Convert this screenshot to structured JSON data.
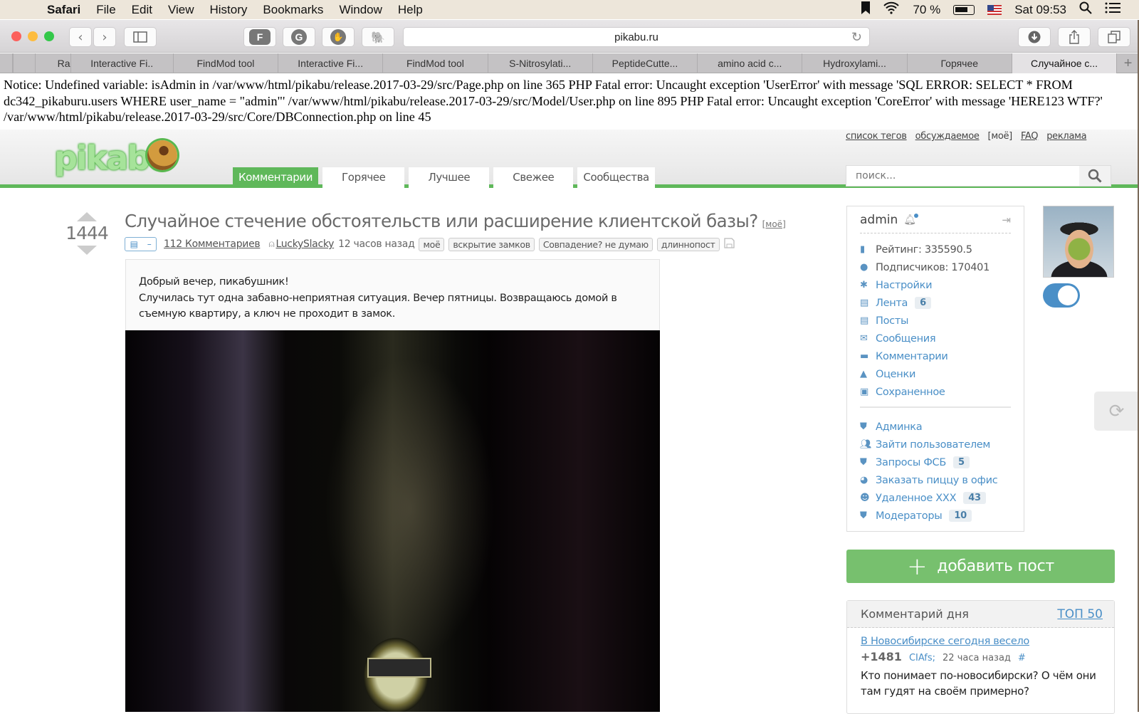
{
  "menubar": {
    "app": "Safari",
    "items": [
      "File",
      "Edit",
      "View",
      "History",
      "Bookmarks",
      "Window",
      "Help"
    ],
    "battery": "70 %",
    "clock": "Sat 09:53"
  },
  "toolbar": {
    "extensions": [
      "F",
      "G",
      "✋",
      "🐘"
    ],
    "url": "pikabu.ru"
  },
  "tabs": [
    {
      "label": ""
    },
    {
      "label": "Ra"
    },
    {
      "label": "Interactive Fi.."
    },
    {
      "label": "FindMod tool"
    },
    {
      "label": "Interactive Fi..."
    },
    {
      "label": "FindMod tool"
    },
    {
      "label": "S-Nitrosylati..."
    },
    {
      "label": "PeptideCutte..."
    },
    {
      "label": "amino acid c..."
    },
    {
      "label": "Hydroxylami..."
    },
    {
      "label": "Горячее"
    },
    {
      "label": "Случайное с..."
    }
  ],
  "error_text": "Notice: Undefined variable: isAdmin in /var/www/html/pikabu/release.2017-03-29/src/Page.php on line 365 PHP Fatal error: Uncaught exception 'UserError' with message 'SQL ERROR: SELECT * FROM dc342_pikaburu.users WHERE user_name = \"admin\"' /var/www/html/pikabu/release.2017-03-29/src/Model/User.php on line 895 PHP Fatal error: Uncaught exception 'CoreError' with message 'HERE123 WTF?' /var/www/html/pikabu/release.2017-03-29/src/Core/DBConnection.php on line 45",
  "header": {
    "logo": "pikabu",
    "nav": [
      "Комментарии",
      "Горячее",
      "Лучшее",
      "Свежее",
      "Сообщества"
    ],
    "top_links": [
      "список тегов",
      "обсуждаемое",
      "[моё]",
      "FAQ",
      "реклама"
    ],
    "search_placeholder": "поиск..."
  },
  "post": {
    "rating": "1444",
    "title": "Случайное стечение обстоятельств или расширение клиентской базы?",
    "title_tag": "[моё]",
    "comments": "112 Комментариев",
    "author": "LuckySlacky",
    "time": "12 часов назад",
    "tags": [
      "моё",
      "вскрытие замков",
      "Совпадение? не думаю",
      "длиннопост"
    ],
    "body_line1": "Добрый вечер, пикабушник!",
    "body_line2": "Случилась тут одна забавно-неприятная ситуация. Вечер пятницы. Возвращаюсь домой в съемную квартиру, а ключ не проходит в замок."
  },
  "user": {
    "name": "admin",
    "rating": "Рейтинг: 335590.5",
    "subscribers": "Подписчиков: 170401",
    "menu": [
      {
        "label": "Настройки",
        "icon": "gear-icon",
        "badge": null
      },
      {
        "label": "Лента",
        "icon": "feed-icon",
        "badge": "6"
      },
      {
        "label": "Посты",
        "icon": "posts-icon",
        "badge": null
      },
      {
        "label": "Сообщения",
        "icon": "mail-icon",
        "badge": null
      },
      {
        "label": "Комментарии",
        "icon": "comment-icon",
        "badge": null
      },
      {
        "label": "Оценки",
        "icon": "triangle-up-icon",
        "badge": null
      },
      {
        "label": "Сохраненное",
        "icon": "save-icon",
        "badge": null
      }
    ],
    "admin_menu": [
      {
        "label": "Админка",
        "icon": "shield-icon",
        "badge": null
      },
      {
        "label": "Зайти пользователем",
        "icon": "users-icon",
        "badge": null
      },
      {
        "label": "Запросы ФСБ",
        "icon": "shield-question-icon",
        "badge": "5"
      },
      {
        "label": "Заказать пиццу в офис",
        "icon": "pie-icon",
        "badge": null
      },
      {
        "label": "Удаленное XXX",
        "icon": "smile-icon",
        "badge": "43"
      },
      {
        "label": "Модераторы",
        "icon": "shield-icon",
        "badge": "10"
      }
    ],
    "toggle_on": true
  },
  "add_post": "добавить пост",
  "comment_of_day": {
    "title": "Комментарий дня",
    "top_link": "ТОП 50",
    "post_link": "В Новосибирске сегодня весело",
    "score": "+1481",
    "author": "CIAfs;",
    "time": "22 часа назад",
    "hash": "#",
    "text": "Кто понимает по-новосибирски? О чём они там гудят на своём примерно?"
  },
  "colors": {
    "brand_green": "#5fb85a",
    "link_blue": "#4a8fc7"
  }
}
